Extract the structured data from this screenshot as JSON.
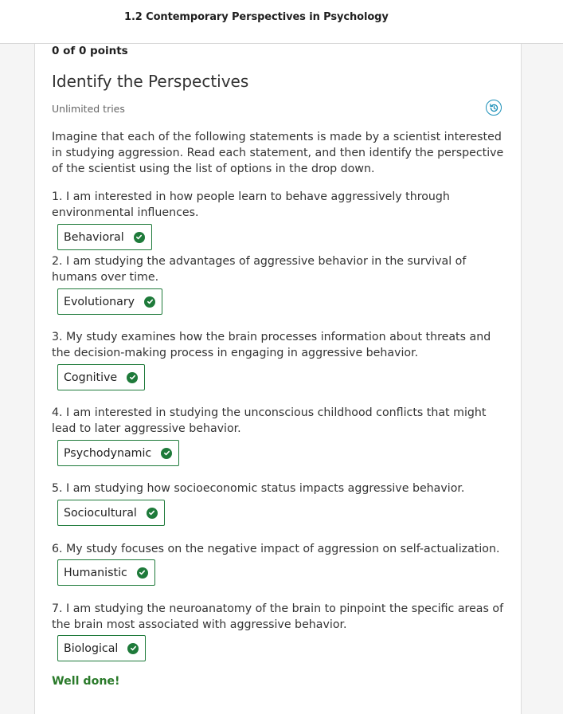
{
  "header": {
    "title": "1.2 Contemporary Perspectives in Psychology"
  },
  "quiz": {
    "points": "0 of 0 points",
    "title": "Identify the Perspectives",
    "tries": "Unlimited tries",
    "intro": "Imagine that each of the following statements is made by a scientist interested in studying aggression. Read each statement, and then identify the perspective of the scientist using the list of options in the drop down.",
    "feedback": "Well done!",
    "history_icon": "history-icon",
    "check_color": "#1e7a3a"
  },
  "questions": [
    {
      "text": "1. I am interested in how people learn to behave aggressively through environmental influences.",
      "answer": "Behavioral",
      "status": "correct"
    },
    {
      "text": "2. I am studying the advantages of aggressive behavior in the survival of humans over time.",
      "answer": "Evolutionary",
      "status": "correct"
    },
    {
      "text": "3. My study examines how the brain processes information about threats and the decision-making process in engaging in aggressive behavior.",
      "answer": "Cognitive",
      "status": "correct"
    },
    {
      "text": "4. I am interested in studying the unconscious childhood conflicts that might lead to later aggressive behavior.",
      "answer": "Psychodynamic",
      "status": "correct"
    },
    {
      "text": "5. I am studying how socioeconomic status impacts aggressive behavior.",
      "answer": "Sociocultural",
      "status": "correct"
    },
    {
      "text": "6. My study focuses on the negative impact of aggression on self-actualization.",
      "answer": "Humanistic",
      "status": "correct"
    },
    {
      "text": "7. I am studying the neuroanatomy of the brain to pinpoint the specific areas of the brain most associated with aggressive behavior.",
      "answer": "Biological",
      "status": "correct"
    }
  ]
}
